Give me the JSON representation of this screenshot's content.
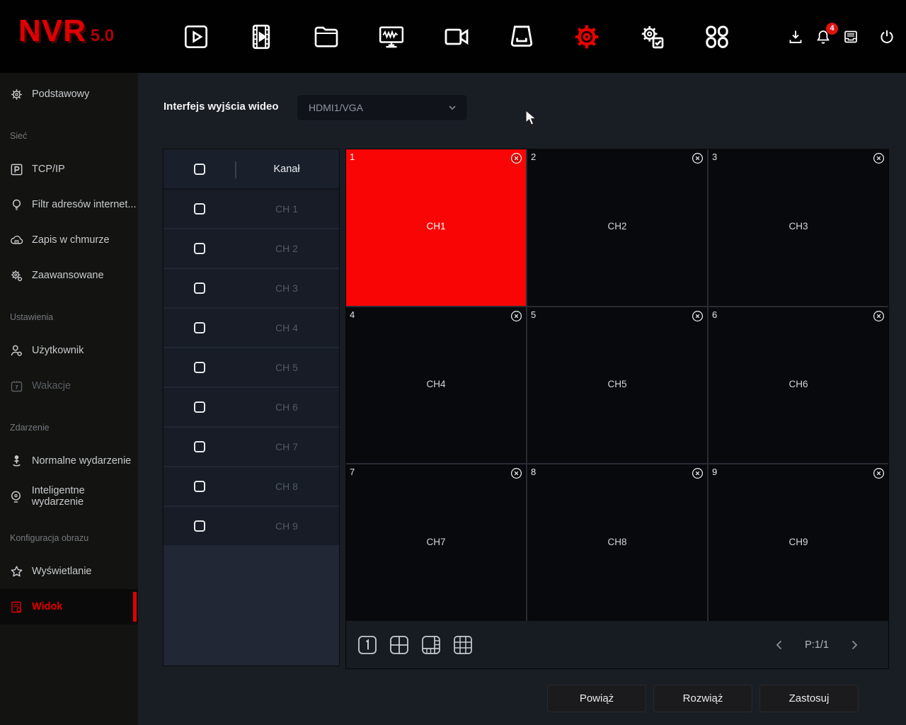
{
  "topbar": {
    "logo": "NVR",
    "version": "5.0",
    "nav_icons": [
      "live-view-icon",
      "playback-icon",
      "file-manager-icon",
      "system-monitor-icon",
      "camera-icon",
      "storage-icon",
      "settings-gear-icon",
      "maintenance-icon",
      "apps-grid-icon"
    ],
    "active_nav": "settings-gear-icon",
    "status_icons": [
      "download-icon",
      "notification-bell-icon",
      "archive-drawer-icon",
      "power-icon"
    ],
    "notification_count": "4",
    "accent_color": "#e00000"
  },
  "sidebar": {
    "sections": [
      {
        "items": [
          {
            "label": "Podstawowy",
            "icon": "gear-icon"
          }
        ]
      },
      {
        "title": "Sieć",
        "items": [
          {
            "label": "TCP/IP",
            "icon": "tcpip-icon"
          },
          {
            "label": "Filtr adresów internet...",
            "icon": "ip-filter-icon"
          },
          {
            "label": "Zapis w chmurze",
            "icon": "cloud-storage-icon"
          },
          {
            "label": "Zaawansowane",
            "icon": "advanced-gear-icon"
          }
        ]
      },
      {
        "title": "Ustawienia",
        "items": [
          {
            "label": "Użytkownik",
            "icon": "user-icon"
          },
          {
            "label": "Wakacje",
            "icon": "calendar-icon",
            "dimmed": true
          }
        ]
      },
      {
        "title": "Zdarzenie",
        "items": [
          {
            "label": "Normalne wydarzenie",
            "icon": "person-event-icon"
          },
          {
            "label": "Inteligentne wydarzenie",
            "icon": "smart-event-icon"
          }
        ]
      },
      {
        "title": "Konfiguracja obrazu",
        "items": [
          {
            "label": "Wyświetlanie",
            "icon": "star-icon"
          },
          {
            "label": "Widok",
            "icon": "view-doc-icon",
            "active": true
          }
        ]
      }
    ]
  },
  "main": {
    "output": {
      "label": "Interfejs wyjścia wideo",
      "value": "HDMI1/VGA"
    },
    "channel_table": {
      "header": "Kanał",
      "rows": [
        "CH 1",
        "CH 2",
        "CH 3",
        "CH 4",
        "CH 5",
        "CH 6",
        "CH 7",
        "CH 8",
        "CH 9"
      ]
    },
    "grid": {
      "cells": [
        {
          "num": "1",
          "label": "CH1",
          "selected": true
        },
        {
          "num": "2",
          "label": "CH2"
        },
        {
          "num": "3",
          "label": "CH3"
        },
        {
          "num": "4",
          "label": "CH4"
        },
        {
          "num": "5",
          "label": "CH5"
        },
        {
          "num": "6",
          "label": "CH6"
        },
        {
          "num": "7",
          "label": "CH7"
        },
        {
          "num": "8",
          "label": "CH8"
        },
        {
          "num": "9",
          "label": "CH9"
        }
      ],
      "selected_color": "#fa0505"
    },
    "toolbar": {
      "layout_icons": [
        "layout-1-icon",
        "layout-4-icon",
        "layout-8-icon",
        "layout-9-icon"
      ],
      "pagination": "P:1/1"
    },
    "buttons": {
      "bind": "Powiąż",
      "unbind": "Rozwiąż",
      "apply": "Zastosuj"
    }
  }
}
